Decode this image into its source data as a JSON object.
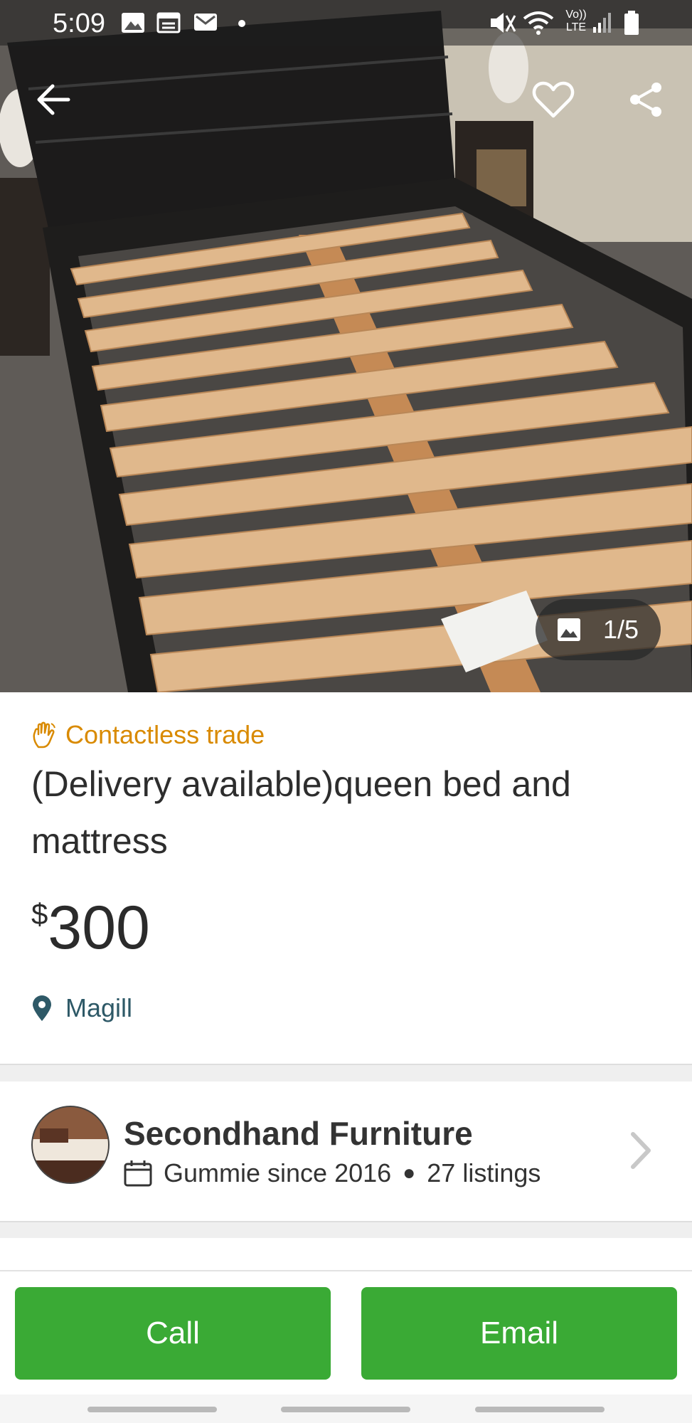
{
  "status_bar": {
    "time": "5:09",
    "left_icons": [
      "image-notification-icon",
      "calendar-notification-icon",
      "gmail-icon",
      "dot-icon"
    ],
    "right_icons": [
      "mute-vibrate-icon",
      "wifi-icon",
      "volte-icon",
      "signal-icon",
      "battery-icon"
    ],
    "volte_label_top": "Vo))",
    "volte_label_bottom": "LTE"
  },
  "hero": {
    "icons": [
      "back-arrow-icon",
      "heart-icon",
      "share-icon",
      "image-icon"
    ],
    "photo_counter": "1/5"
  },
  "listing": {
    "contactless_label": "Contactless trade",
    "title": "(Delivery available)queen bed and mattress",
    "price_currency": "$",
    "price_amount": "300",
    "location": "Magill"
  },
  "seller": {
    "name": "Secondhand Furniture",
    "member_since": "Gummie since 2016",
    "listings": "27 listings"
  },
  "actions": {
    "call_label": "Call",
    "email_label": "Email"
  },
  "colors": {
    "accent_green": "#3aaa35",
    "contactless_orange": "#d98a00",
    "location_teal": "#2e5967"
  }
}
